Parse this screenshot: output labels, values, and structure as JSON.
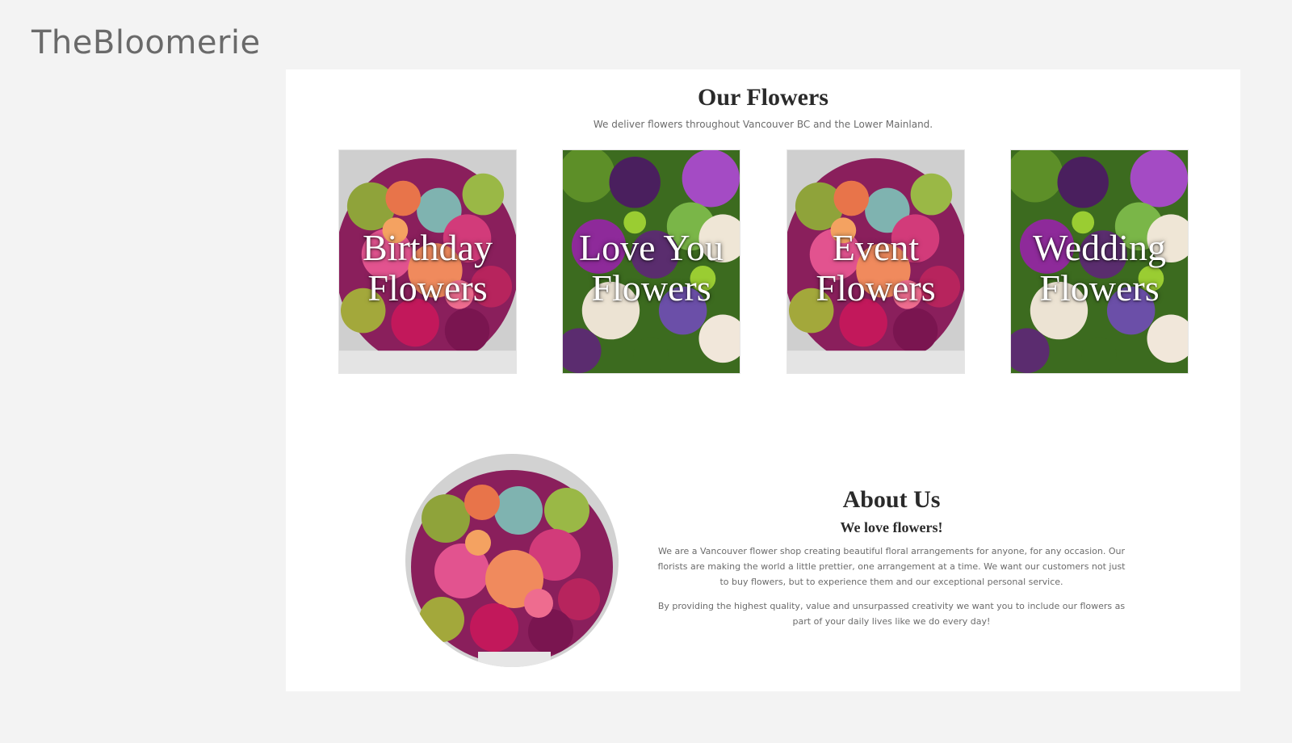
{
  "brand": {
    "name": "TheBloomerie"
  },
  "flowers_section": {
    "title": "Our Flowers",
    "subtitle": "We deliver flowers throughout Vancouver BC and the Lower Mainland.",
    "cards": [
      {
        "label": "Birthday\nFlowers",
        "palette": "bright-bouquet"
      },
      {
        "label": "Love You\nFlowers",
        "palette": "purple-green"
      },
      {
        "label": "Event\nFlowers",
        "palette": "bright-bouquet"
      },
      {
        "label": "Wedding\nFlowers",
        "palette": "purple-green"
      }
    ]
  },
  "about_section": {
    "title": "About Us",
    "subtitle": "We love flowers!",
    "paragraphs": [
      "We are a Vancouver flower shop creating beautiful floral arrangements for anyone, for any occasion. Our florists are making the world a little prettier, one arrangement at a time. We want our customers not just to buy flowers, but to experience them and our exceptional personal service.",
      "By providing the highest quality, value and unsurpassed creativity we want you to include our flowers as part of your daily lives like we do every day!"
    ]
  },
  "colors": {
    "page_background": "#f3f3f3",
    "panel_background": "#ffffff",
    "heading_text": "#2a2a2a",
    "body_text": "#6b6b6b",
    "brand_text": "#6a6a6a"
  }
}
